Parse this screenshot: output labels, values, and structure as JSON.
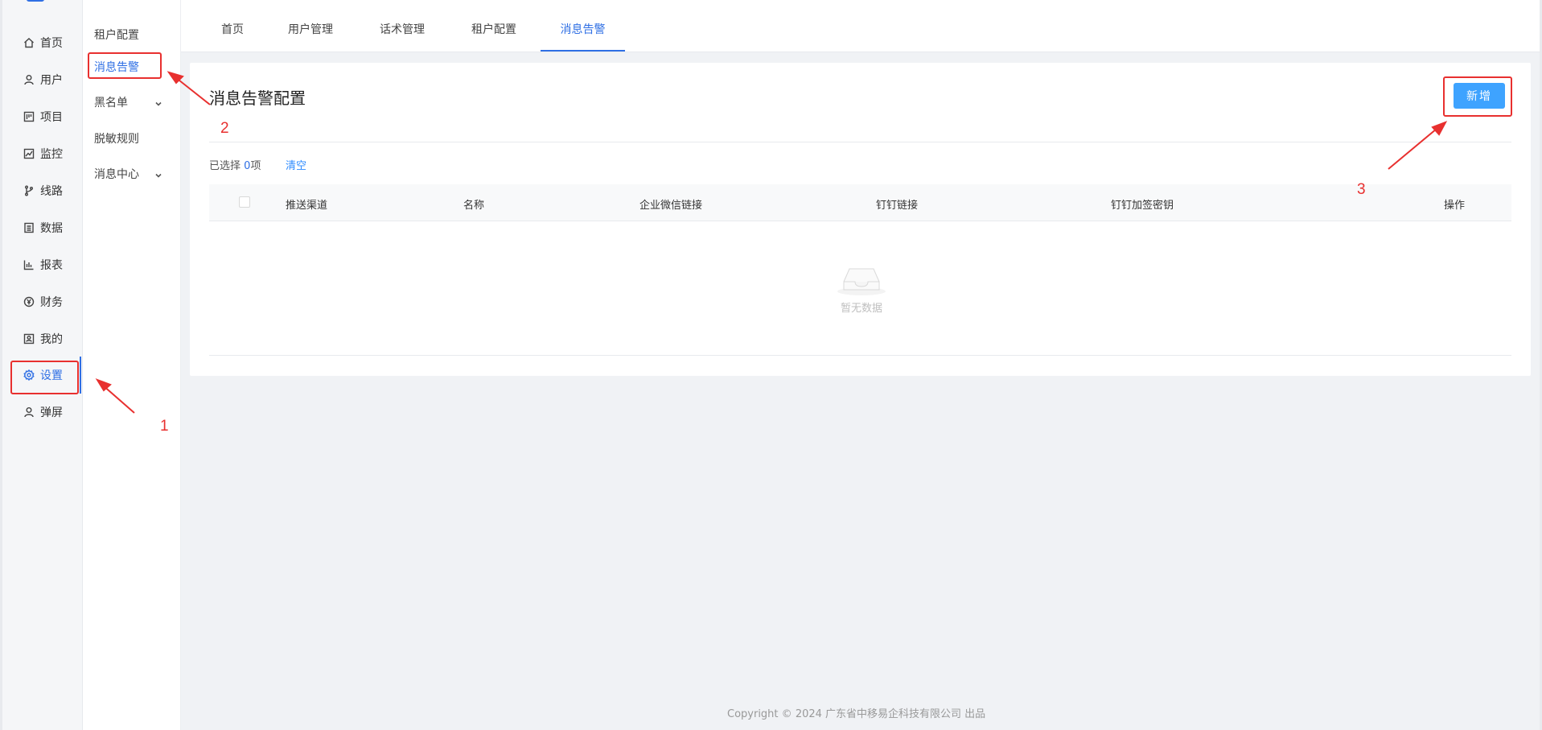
{
  "sidebar": {
    "items": [
      {
        "label": "首页",
        "icon": "home-icon"
      },
      {
        "label": "用户",
        "icon": "user-icon"
      },
      {
        "label": "项目",
        "icon": "project-icon"
      },
      {
        "label": "监控",
        "icon": "monitor-icon"
      },
      {
        "label": "线路",
        "icon": "branch-icon"
      },
      {
        "label": "数据",
        "icon": "data-icon"
      },
      {
        "label": "报表",
        "icon": "chart-icon"
      },
      {
        "label": "财务",
        "icon": "yen-icon"
      },
      {
        "label": "我的",
        "icon": "profile-icon"
      },
      {
        "label": "设置",
        "icon": "gear-icon",
        "active": true
      },
      {
        "label": "弹屏",
        "icon": "user-icon"
      }
    ]
  },
  "subnav": {
    "items": [
      {
        "label": "租户配置"
      },
      {
        "label": "消息告警",
        "active": true
      },
      {
        "label": "黑名单",
        "expandable": true
      },
      {
        "label": "脱敏规则"
      },
      {
        "label": "消息中心",
        "expandable": true
      }
    ]
  },
  "tabs": [
    {
      "label": "首页"
    },
    {
      "label": "用户管理"
    },
    {
      "label": "话术管理"
    },
    {
      "label": "租户配置"
    },
    {
      "label": "消息告警",
      "active": true
    }
  ],
  "main": {
    "title": "消息告警配置",
    "add_label": "新增",
    "selected_prefix": "已选择",
    "selected_count": "0",
    "selected_suffix": "项",
    "clear_label": "清空",
    "columns": [
      "推送渠道",
      "名称",
      "企业微信链接",
      "钉钉链接",
      "钉钉加签密钥",
      "操作"
    ],
    "empty_text": "暂无数据"
  },
  "footer": {
    "prefix": "Copyright",
    "copyright_symbol": "©",
    "text": "2024 广东省中移易企科技有限公司 出品"
  },
  "annotations": [
    "1",
    "2",
    "3"
  ],
  "colors": {
    "accent": "#2f6fe4",
    "button": "#3ea3ff",
    "annotation": "#e8302f"
  }
}
